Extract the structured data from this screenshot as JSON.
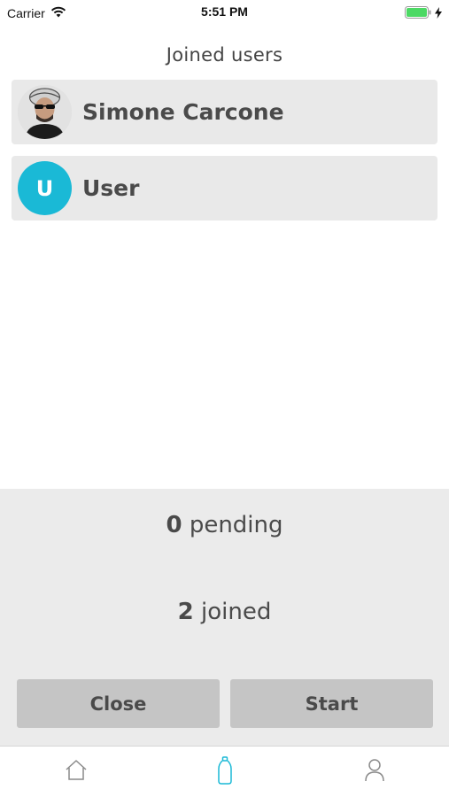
{
  "status_bar": {
    "carrier": "Carrier",
    "time": "5:51 PM"
  },
  "header": {
    "title": "Joined users"
  },
  "users": [
    {
      "name": "Simone Carcone",
      "avatar_type": "photo"
    },
    {
      "name": "User",
      "avatar_type": "letter",
      "avatar_letter": "U",
      "avatar_color": "#1ab9d6"
    }
  ],
  "summary": {
    "pending_count": "0",
    "pending_label": "pending",
    "joined_count": "2",
    "joined_label": "joined"
  },
  "actions": {
    "close_label": "Close",
    "start_label": "Start"
  },
  "tabbar": {
    "items": [
      {
        "icon": "home-icon",
        "active": false
      },
      {
        "icon": "bottle-icon",
        "active": true,
        "color": "#1ab9d6"
      },
      {
        "icon": "profile-icon",
        "active": false
      }
    ]
  },
  "colors": {
    "accent": "#1ab9d6",
    "row_background": "#e9e9e9",
    "panel_background": "#ebebeb",
    "button_background": "#c5c5c5",
    "battery": "#4cd964"
  }
}
